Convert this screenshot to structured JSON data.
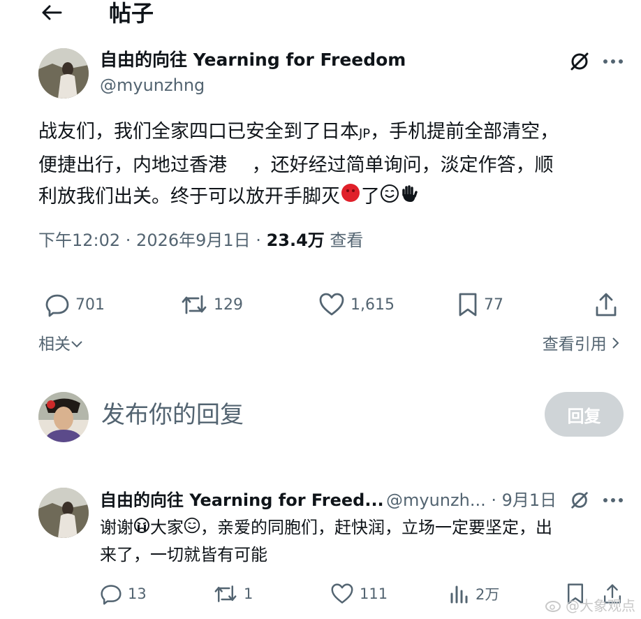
{
  "header": {
    "title": "帖子"
  },
  "post": {
    "author_name": "自由的向往 Yearning for Freedom",
    "author_handle": "@myunzhng",
    "text_line1_a": "战友们，我们全家四口已安全到了日本",
    "text_line1_jp": "JP",
    "text_line1_b": "，手机提前全部清空，",
    "text_line2": "便捷出行，内地过香港　 ，还好经过简单询问，淡定作答，顺",
    "text_line3": "利放我们出关。终于可以放开手脚灭",
    "text_line3_tail": "了",
    "time": "下午12:02 · 2026年9月1日 · ",
    "views_count": "23.4万",
    "views_label": " 查看",
    "replies": "701",
    "reposts": "129",
    "likes": "1,615",
    "bookmarks": "77",
    "related_label": "相关",
    "view_quotes_label": "查看引用"
  },
  "reply_box": {
    "placeholder": "发布你的回复",
    "button_label": "回复"
  },
  "reply": {
    "author_name": "自由的向往 Yearning for Freed...",
    "meta": "@myunzh... · 9月1日",
    "text_line1_a": "谢谢",
    "text_line1_b": "大家",
    "text_line1_c": "，亲爱的同胞们，赶快润，立场一定要坚定，出",
    "text_line2": "来了，一切就皆有可能",
    "replies": "13",
    "reposts": "1",
    "likes": "111",
    "views": "2万"
  },
  "watermark": {
    "text": "@大象观点"
  },
  "colors": {
    "text": "#0f1419",
    "secondary": "#536471",
    "reply_button": "#cfd4d7"
  }
}
